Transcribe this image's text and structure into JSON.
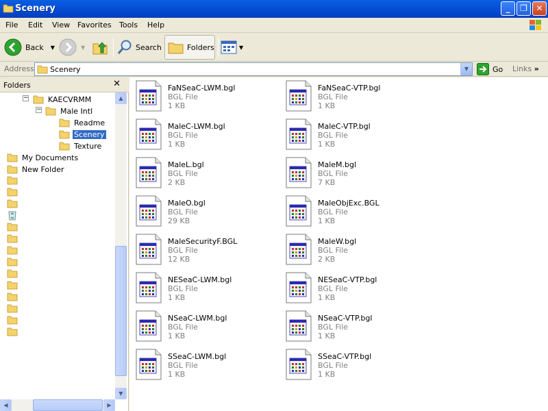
{
  "window": {
    "title": "Scenery"
  },
  "menu": [
    "File",
    "Edit",
    "View",
    "Favorites",
    "Tools",
    "Help"
  ],
  "toolbar": {
    "back": "Back",
    "search": "Search",
    "folders": "Folders"
  },
  "address": {
    "label": "Address",
    "value": "Scenery",
    "go": "Go",
    "links": "Links"
  },
  "folders_pane": {
    "title": "Folders",
    "tree": [
      {
        "label": "KAECVRMM",
        "level": 2,
        "expanded": true
      },
      {
        "label": "Male Intl",
        "level": 3,
        "expanded": true
      },
      {
        "label": "Readme",
        "level": 4
      },
      {
        "label": "Scenery",
        "level": 4,
        "selected": true
      },
      {
        "label": "Texture",
        "level": 4
      },
      {
        "label": "My Documents",
        "level": 0
      },
      {
        "label": "New Folder",
        "level": 0
      }
    ]
  },
  "files": [
    {
      "name": "FaNSeaC-LWM.bgl",
      "type": "BGL File",
      "size": "1 KB"
    },
    {
      "name": "FaNSeaC-VTP.bgl",
      "type": "BGL File",
      "size": "1 KB"
    },
    {
      "name": "MaleC-LWM.bgl",
      "type": "BGL File",
      "size": "1 KB"
    },
    {
      "name": "MaleC-VTP.bgl",
      "type": "BGL File",
      "size": "1 KB"
    },
    {
      "name": "MaleL.bgl",
      "type": "BGL File",
      "size": "2 KB"
    },
    {
      "name": "MaleM.bgl",
      "type": "BGL File",
      "size": "7 KB"
    },
    {
      "name": "MaleO.bgl",
      "type": "BGL File",
      "size": "29 KB"
    },
    {
      "name": "MaleObjExc.BGL",
      "type": "BGL File",
      "size": "1 KB"
    },
    {
      "name": "MaleSecurityF.BGL",
      "type": "BGL File",
      "size": "12 KB"
    },
    {
      "name": "MaleW.bgl",
      "type": "BGL File",
      "size": "2 KB"
    },
    {
      "name": "NESeaC-LWM.bgl",
      "type": "BGL File",
      "size": "1 KB"
    },
    {
      "name": "NESeaC-VTP.bgl",
      "type": "BGL File",
      "size": "1 KB"
    },
    {
      "name": "NSeaC-LWM.bgl",
      "type": "BGL File",
      "size": "1 KB"
    },
    {
      "name": "NSeaC-VTP.bgl",
      "type": "BGL File",
      "size": "1 KB"
    },
    {
      "name": "SSeaC-LWM.bgl",
      "type": "BGL File",
      "size": "1 KB"
    },
    {
      "name": "SSeaC-VTP.bgl",
      "type": "BGL File",
      "size": "1 KB"
    }
  ],
  "colors": {
    "titlebar": "#0551d8",
    "selection": "#316ac5",
    "chrome": "#ece9d8"
  }
}
